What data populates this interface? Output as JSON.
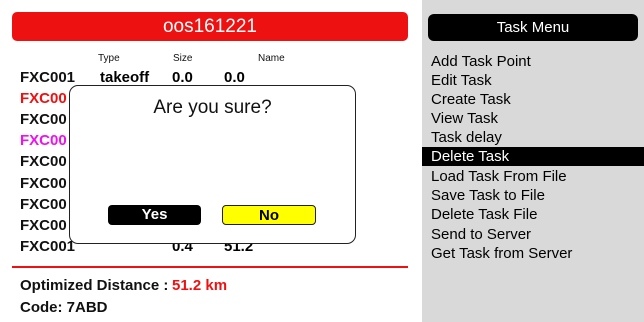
{
  "task": {
    "name": "oos161221",
    "columns": {
      "type": "Type",
      "size": "Size",
      "name": "Name"
    },
    "rows": [
      {
        "code": "FXC001",
        "type": "takeoff",
        "size": "0.0",
        "name": "0.0",
        "color": "#111111"
      },
      {
        "code": "FXC00",
        "type": "",
        "size": "",
        "name": "",
        "color": "#ee1111"
      },
      {
        "code": "FXC00",
        "type": "",
        "size": "",
        "name": "",
        "color": "#111111"
      },
      {
        "code": "FXC00",
        "type": "",
        "size": "",
        "name": "",
        "color": "#ee11ee"
      },
      {
        "code": "FXC00",
        "type": "",
        "size": "",
        "name": "",
        "color": "#111111"
      },
      {
        "code": "FXC00",
        "type": "",
        "size": "",
        "name": "",
        "color": "#111111"
      },
      {
        "code": "FXC00",
        "type": "",
        "size": "",
        "name": "",
        "color": "#111111"
      },
      {
        "code": "FXC00",
        "type": "",
        "size": "",
        "name": "",
        "color": "#111111"
      },
      {
        "code": "FXC001",
        "type": "",
        "size": "0.4",
        "name": "51.2",
        "color": "#111111"
      }
    ],
    "optimized_label": "Optimized Distance :",
    "optimized_value": "51.2 km",
    "code_label": "Code: 7ABD"
  },
  "dialog": {
    "title": "Are you sure?",
    "yes": "Yes",
    "no": "No"
  },
  "menu": {
    "title": "Task Menu",
    "selected_index": 5,
    "items": [
      "Add Task Point",
      "Edit Task",
      "Create Task",
      "View Task",
      "Task delay",
      "Delete Task",
      "Load Task From File",
      "Save Task to File",
      "Delete Task File",
      "Send to Server",
      "Get Task from Server"
    ]
  },
  "colors": {
    "accent_red": "#ee1111",
    "yes_button": "#000000",
    "no_button": "#ffff00",
    "menu_background": "#d9d9d9"
  }
}
